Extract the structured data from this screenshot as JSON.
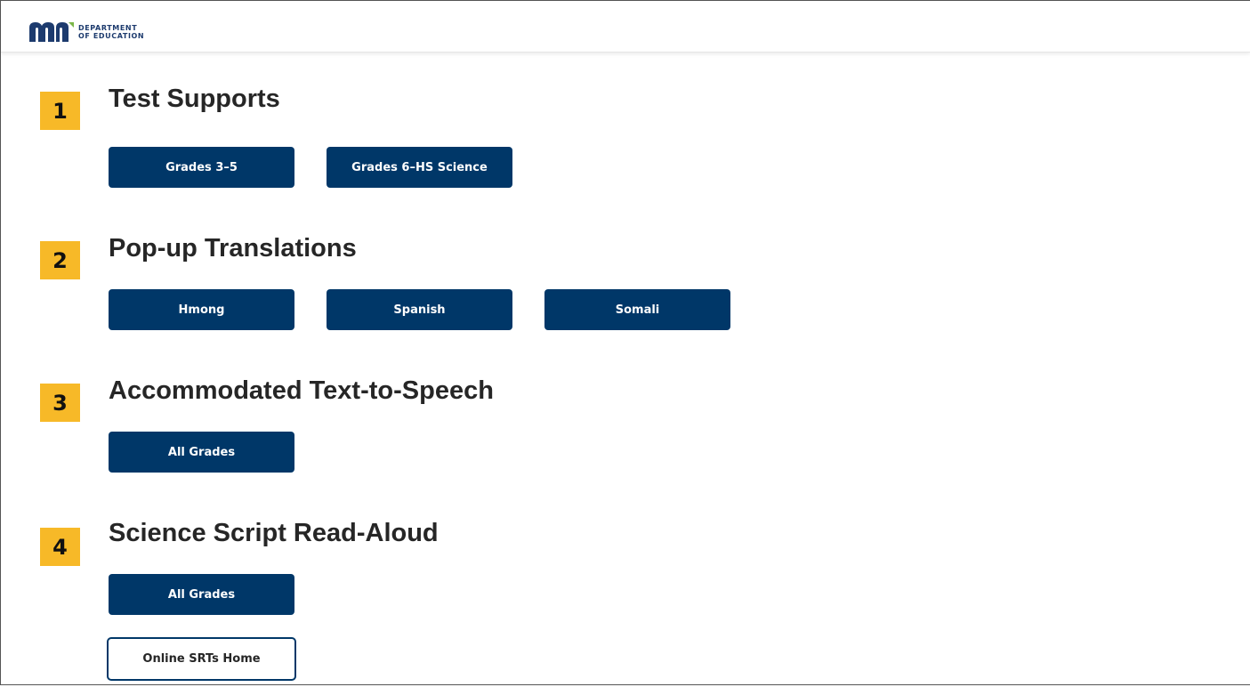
{
  "header": {
    "logo_line1": "DEPARTMENT",
    "logo_line2": "OF EDUCATION",
    "logo_mark_color": "#1d3b6e",
    "logo_accent_color": "#7ab648"
  },
  "colors": {
    "badge": "#f7b928",
    "button_bg": "#003768",
    "button_text": "#ffffff",
    "heading_text": "#262626"
  },
  "sections": [
    {
      "number": "1",
      "title": "Test Supports",
      "buttons": [
        "Grades 3–5",
        "Grades 6–HS Science"
      ]
    },
    {
      "number": "2",
      "title": "Pop-up Translations",
      "buttons": [
        "Hmong",
        "Spanish",
        "Somali"
      ]
    },
    {
      "number": "3",
      "title": "Accommodated Text-to-Speech",
      "buttons": [
        "All Grades"
      ]
    },
    {
      "number": "4",
      "title": "Science Script Read-Aloud",
      "buttons": [
        "All Grades"
      ],
      "secondary_button": "Online SRTs Home"
    }
  ]
}
